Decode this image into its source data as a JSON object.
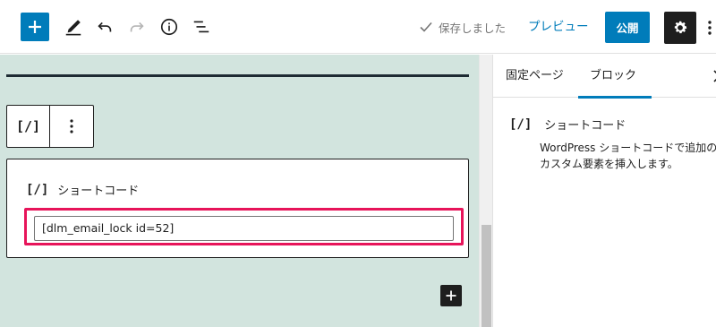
{
  "toolbar": {
    "saved_label": "保存しました",
    "preview_label": "プレビュー",
    "publish_label": "公開"
  },
  "block_toolbar": {
    "type_icon_glyph": "[/]"
  },
  "shortcode_block": {
    "icon_glyph": "[/]",
    "label": "ショートコード",
    "value": "[dlm_email_lock id=52]"
  },
  "sidebar": {
    "tabs": [
      {
        "label": "固定ページ",
        "active": false
      },
      {
        "label": "ブロック",
        "active": true
      }
    ],
    "block_card": {
      "icon_glyph": "[/]",
      "title": "ショートコード",
      "description_line1": "WordPress ショートコードで追加の",
      "description_line2": "カスタム要素を挿入します。"
    }
  },
  "colors": {
    "accent": "#007cba",
    "highlight": "#e7145a",
    "canvas_bg": "#d2e4de"
  }
}
